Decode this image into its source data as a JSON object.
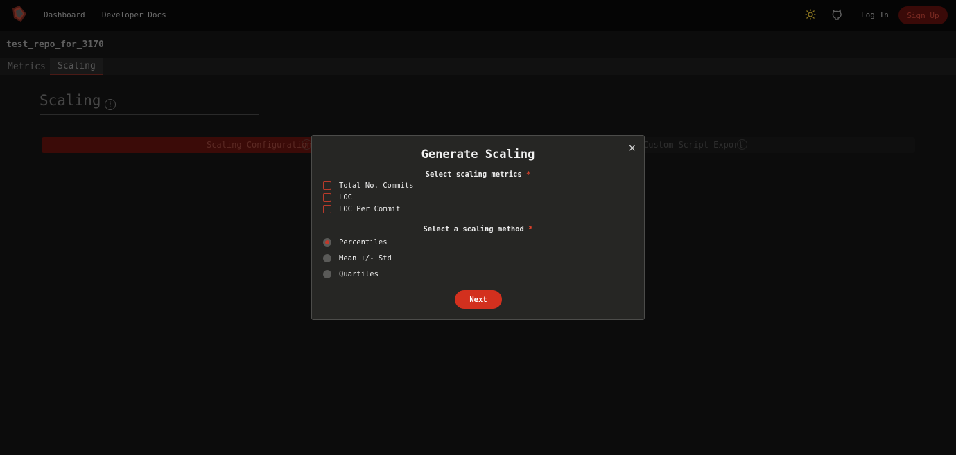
{
  "nav": {
    "links": [
      "Dashboard",
      "Developer Docs"
    ],
    "login_label": "Log In",
    "signup_label": "Sign Up"
  },
  "repo": {
    "title": "test_repo_for_3170"
  },
  "tabs": [
    {
      "label": "Metrics",
      "active": false
    },
    {
      "label": "Scaling",
      "active": true
    }
  ],
  "page": {
    "heading": "Scaling",
    "info_glyph": "i",
    "steps": [
      "Scaling Configuration",
      "Custom Script Export"
    ]
  },
  "modal": {
    "title": "Generate Scaling",
    "close_glyph": "×",
    "metrics_label": "Select scaling metrics",
    "method_label": "Select a scaling method",
    "required_mark": "*",
    "metrics": [
      "Total No. Commits",
      "LOC",
      "LOC Per Commit"
    ],
    "methods": [
      "Percentiles",
      "Mean +/- Std",
      "Quartiles"
    ],
    "selected_method": "Percentiles",
    "next_label": "Next"
  },
  "colors": {
    "accent": "#d3301e",
    "background": "#0c0c0c",
    "modal_bg": "#262624"
  }
}
